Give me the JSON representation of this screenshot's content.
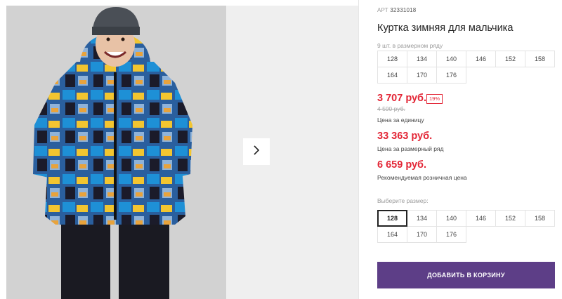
{
  "product": {
    "art_label": "АРТ",
    "art_number": "32331018",
    "title": "Куртка зимняя для мальчика"
  },
  "sizes_row_note": "9 шт. в размерном ряду",
  "sizes_row": [
    "128",
    "134",
    "140",
    "146",
    "152",
    "158",
    "164",
    "170",
    "176"
  ],
  "prices": {
    "unit_price": "3 707 руб.",
    "discount_badge": "19%",
    "old_price": "4 590 руб.",
    "unit_caption": "Цена за единицу",
    "row_price": "33 363 руб.",
    "row_caption": "Цена за размерный ряд",
    "retail_price": "6 659 руб.",
    "retail_caption": "Рекомендуемая розничная цена"
  },
  "size_select": {
    "label": "Выберите размер:",
    "options": [
      "128",
      "134",
      "140",
      "146",
      "152",
      "158",
      "164",
      "170",
      "176"
    ],
    "selected": "128"
  },
  "cart_button": "ДОБАВИТЬ В КОРЗИНУ",
  "colors": {
    "accent_red": "#e32636",
    "button_purple": "#5d3e87"
  },
  "icons": {
    "next": "chevron-right-icon"
  }
}
